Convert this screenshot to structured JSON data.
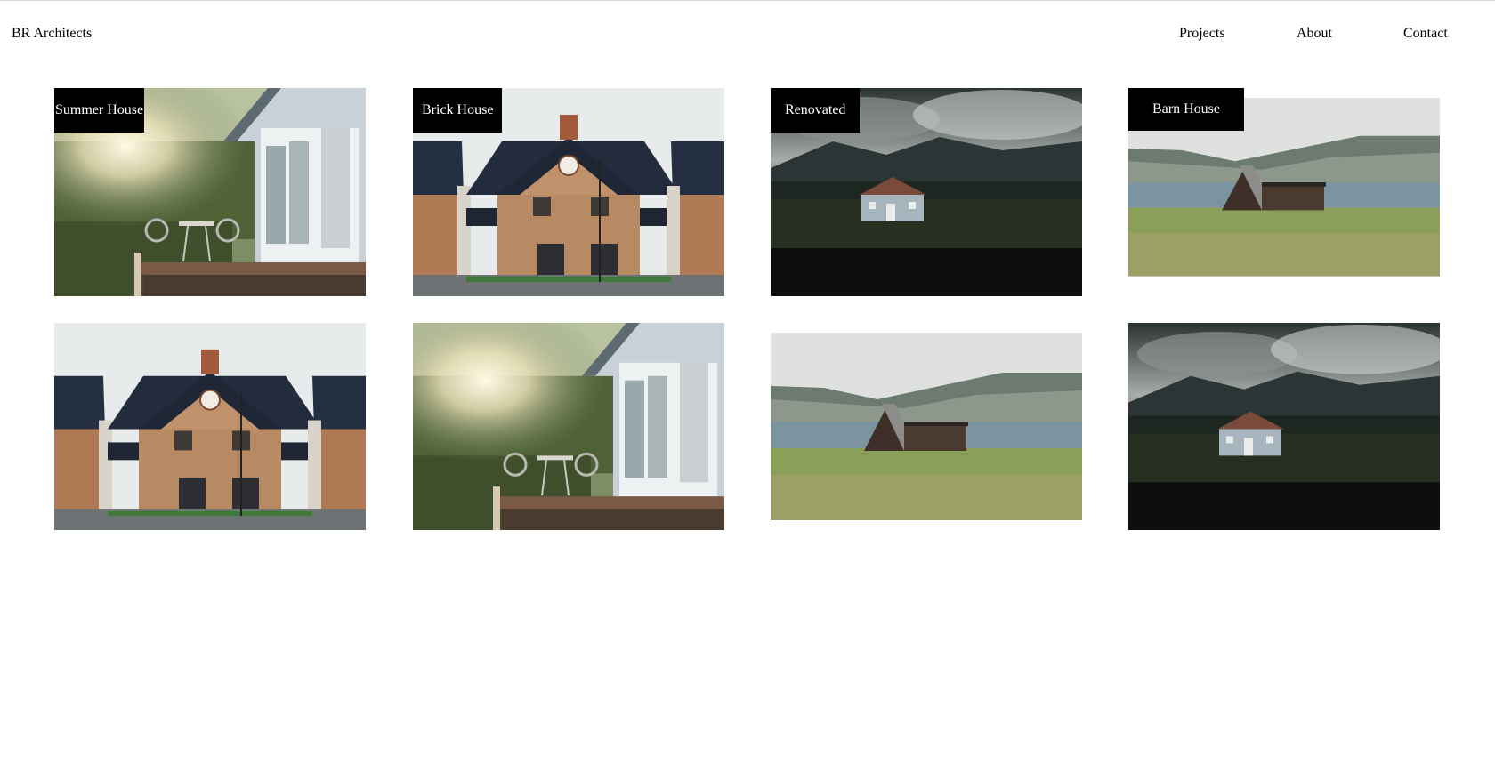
{
  "site": {
    "brand": "BR Architects",
    "nav": [
      {
        "label": "Projects"
      },
      {
        "label": "About"
      },
      {
        "label": "Contact"
      }
    ]
  },
  "gallery": {
    "projects": [
      {
        "label": "Summer House",
        "image": "summer-house-photo"
      },
      {
        "label": "Brick House",
        "image": "brick-house-photo"
      },
      {
        "label": "Renovated",
        "image": "renovated-house-photo"
      },
      {
        "label": "Barn House",
        "image": "barn-house-photo"
      },
      {
        "label": "",
        "image": "brick-house-photo"
      },
      {
        "label": "",
        "image": "summer-house-photo"
      },
      {
        "label": "",
        "image": "barn-house-photo"
      },
      {
        "label": "",
        "image": "renovated-house-photo"
      }
    ]
  }
}
